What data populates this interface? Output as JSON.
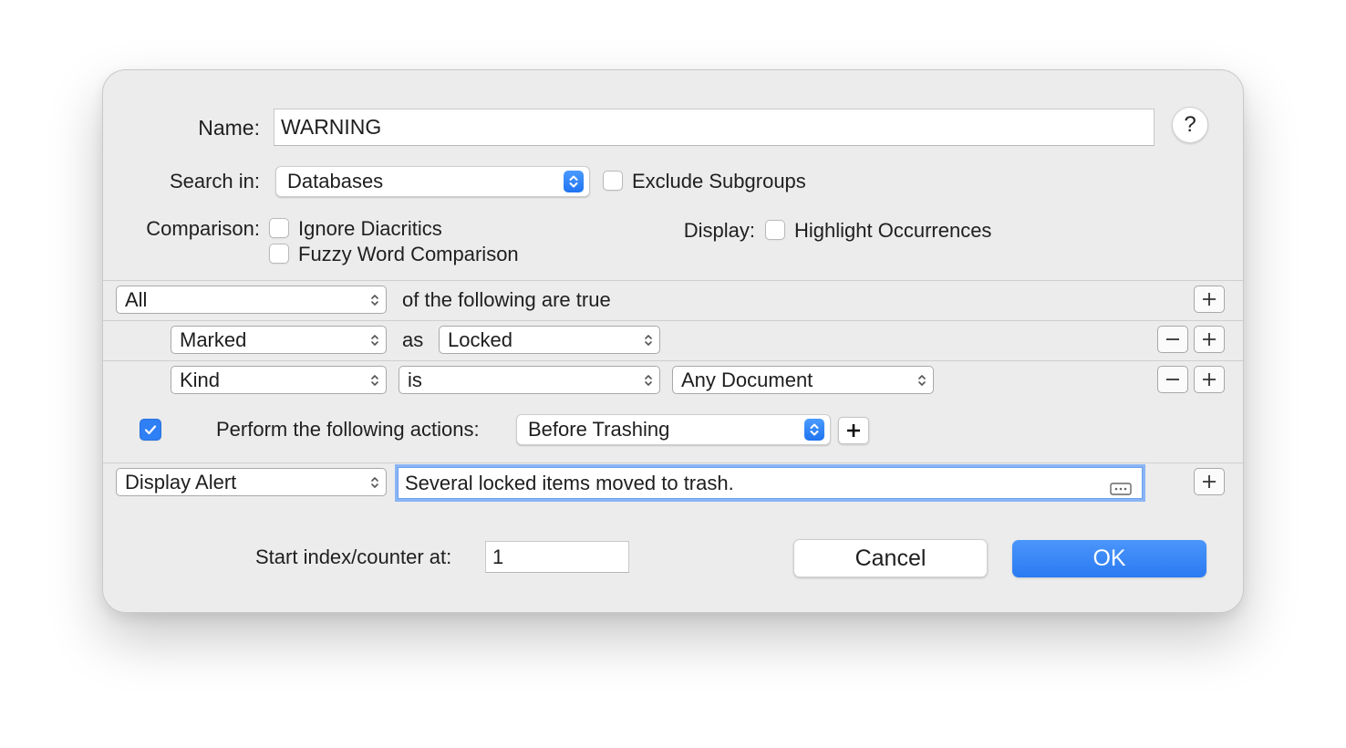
{
  "dialog": {
    "name": {
      "label": "Name:",
      "value": "WARNING"
    },
    "help_label": "?",
    "search_in": {
      "label": "Search in:",
      "value": "Databases",
      "exclude_subgroups_label": "Exclude Subgroups",
      "exclude_subgroups_checked": false
    },
    "comparison": {
      "label": "Comparison:",
      "ignore_diacritics_label": "Ignore Diacritics",
      "ignore_diacritics_checked": false,
      "fuzzy_word_label": "Fuzzy Word Comparison",
      "fuzzy_word_checked": false
    },
    "display": {
      "label": "Display:",
      "highlight_label": "Highlight Occurrences",
      "highlight_checked": false
    },
    "conditions": {
      "match": "All",
      "match_suffix": "of the following are true",
      "rows": [
        {
          "field": "Marked",
          "operator_text": "as",
          "value": "Locked"
        },
        {
          "field": "Kind",
          "operator": "is",
          "value": "Any Document"
        }
      ]
    },
    "actions": {
      "enabled": true,
      "label": "Perform the following actions:",
      "trigger": "Before Trashing",
      "rows": [
        {
          "action": "Display Alert",
          "message": "Several locked items moved to trash."
        }
      ]
    },
    "start_index": {
      "label": "Start index/counter at:",
      "value": "1"
    },
    "buttons": {
      "cancel": "Cancel",
      "ok": "OK"
    }
  }
}
